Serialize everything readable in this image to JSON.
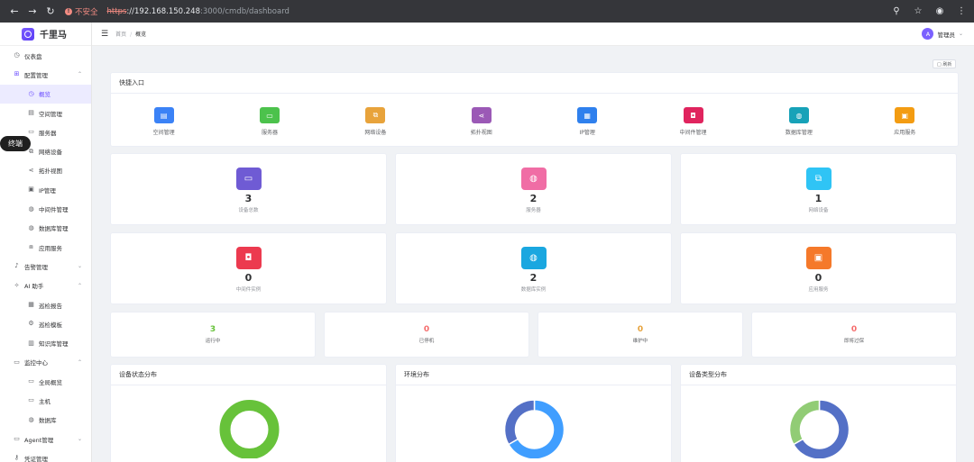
{
  "browser": {
    "warning": "不安全",
    "url_scheme": "https",
    "url_host": "://192.168.150.248",
    "url_path": ":3000/cmdb/dashboard"
  },
  "app": {
    "name": "千里马"
  },
  "header": {
    "breadcrumb": [
      "首页",
      "概览"
    ],
    "user": "管理员",
    "avatar_letter": "A"
  },
  "sidebar": {
    "terminal_badge": "终端",
    "items": [
      {
        "label": "仪表盘",
        "icon": "dashboard-icon",
        "level": "top"
      },
      {
        "label": "配置管理",
        "icon": "grid-icon",
        "level": "top",
        "expanded": true
      },
      {
        "label": "概览",
        "icon": "dashboard-icon",
        "level": "sub",
        "active": true
      },
      {
        "label": "空间管理",
        "icon": "building-icon",
        "level": "sub"
      },
      {
        "label": "服务器",
        "icon": "monitor-icon",
        "level": "sub"
      },
      {
        "label": "网络设备",
        "icon": "router-icon",
        "level": "sub"
      },
      {
        "label": "拓扑视图",
        "icon": "share-icon",
        "level": "sub"
      },
      {
        "label": "IP管理",
        "icon": "ip-icon",
        "level": "sub"
      },
      {
        "label": "中间件管理",
        "icon": "database-icon",
        "level": "sub"
      },
      {
        "label": "数据库管理",
        "icon": "database-icon",
        "level": "sub"
      },
      {
        "label": "应用服务",
        "icon": "app-icon",
        "level": "sub"
      },
      {
        "label": "告警管理",
        "icon": "bell-icon",
        "level": "top",
        "expanded": false
      },
      {
        "label": "AI 助手",
        "icon": "ai-icon",
        "level": "top",
        "expanded": true
      },
      {
        "label": "巡检报告",
        "icon": "report-icon",
        "level": "sub"
      },
      {
        "label": "巡检模板",
        "icon": "gear-icon",
        "level": "sub"
      },
      {
        "label": "知识库管理",
        "icon": "book-icon",
        "level": "sub"
      },
      {
        "label": "监控中心",
        "icon": "monitor-icon",
        "level": "top",
        "expanded": true
      },
      {
        "label": "全局概览",
        "icon": "monitor-icon",
        "level": "sub"
      },
      {
        "label": "主机",
        "icon": "monitor-icon",
        "level": "sub"
      },
      {
        "label": "数据库",
        "icon": "database-icon",
        "level": "sub"
      },
      {
        "label": "Agent管理",
        "icon": "monitor-icon",
        "level": "top",
        "expanded": false
      },
      {
        "label": "凭证管理",
        "icon": "key-icon",
        "level": "top"
      }
    ]
  },
  "toolbar": {
    "refresh_label": "□ 刷新"
  },
  "quick_entry": {
    "title": "快捷入口",
    "items": [
      {
        "label": "空间管理",
        "color": "#3b82f6",
        "glyph": "▤",
        "icon": "building-icon"
      },
      {
        "label": "服务器",
        "color": "#4cc24c",
        "glyph": "▭",
        "icon": "monitor-icon"
      },
      {
        "label": "网络设备",
        "color": "#e8a33b",
        "glyph": "⧉",
        "icon": "router-icon"
      },
      {
        "label": "拓扑视图",
        "color": "#9b59b6",
        "glyph": "⋖",
        "icon": "share-icon"
      },
      {
        "label": "IP管理",
        "color": "#2f80ed",
        "glyph": "▦",
        "icon": "grid-icon"
      },
      {
        "label": "中间件管理",
        "color": "#e0245e",
        "glyph": "◘",
        "icon": "chip-icon"
      },
      {
        "label": "数据库管理",
        "color": "#17a2b8",
        "glyph": "◍",
        "icon": "database-icon"
      },
      {
        "label": "应用服务",
        "color": "#f39c12",
        "glyph": "▣",
        "icon": "app-icon"
      }
    ]
  },
  "stats": [
    {
      "value": "3",
      "label": "设备总数",
      "color": "#6f5bd4",
      "glyph": "▭",
      "icon": "monitor-icon"
    },
    {
      "value": "2",
      "label": "服务器",
      "color": "#f06da5",
      "glyph": "◍",
      "icon": "database-icon"
    },
    {
      "value": "1",
      "label": "网络设备",
      "color": "#2fc4f5",
      "glyph": "⧉",
      "icon": "router-icon"
    },
    {
      "value": "0",
      "label": "中间件实例",
      "color": "#ec3a4f",
      "glyph": "◘",
      "icon": "chip-icon"
    },
    {
      "value": "2",
      "label": "数据库实例",
      "color": "#1aa7e0",
      "glyph": "◍",
      "icon": "database-icon"
    },
    {
      "value": "0",
      "label": "应用服务",
      "color": "#f5792a",
      "glyph": "▣",
      "icon": "app-icon"
    }
  ],
  "status": [
    {
      "value": "3",
      "label": "运行中",
      "color": "#67c23a"
    },
    {
      "value": "0",
      "label": "已停机",
      "color": "#f56c6c"
    },
    {
      "value": "0",
      "label": "维护中",
      "color": "#e6a23c"
    },
    {
      "value": "0",
      "label": "即将过保",
      "color": "#f56c6c"
    }
  ],
  "charts": {
    "titles": [
      "设备状态分布",
      "环境分布",
      "设备类型分布"
    ]
  },
  "chart_data": [
    {
      "type": "pie",
      "title": "设备状态分布",
      "slices": [
        {
          "value": 3,
          "color": "#67c23a"
        }
      ]
    },
    {
      "type": "pie",
      "title": "环境分布",
      "slices": [
        {
          "value": 2,
          "color": "#409eff"
        },
        {
          "value": 1,
          "color": "#5470c6"
        }
      ]
    },
    {
      "type": "pie",
      "title": "设备类型分布",
      "slices": [
        {
          "value": 2,
          "color": "#5470c6"
        },
        {
          "value": 1,
          "color": "#91cc75"
        }
      ]
    }
  ]
}
